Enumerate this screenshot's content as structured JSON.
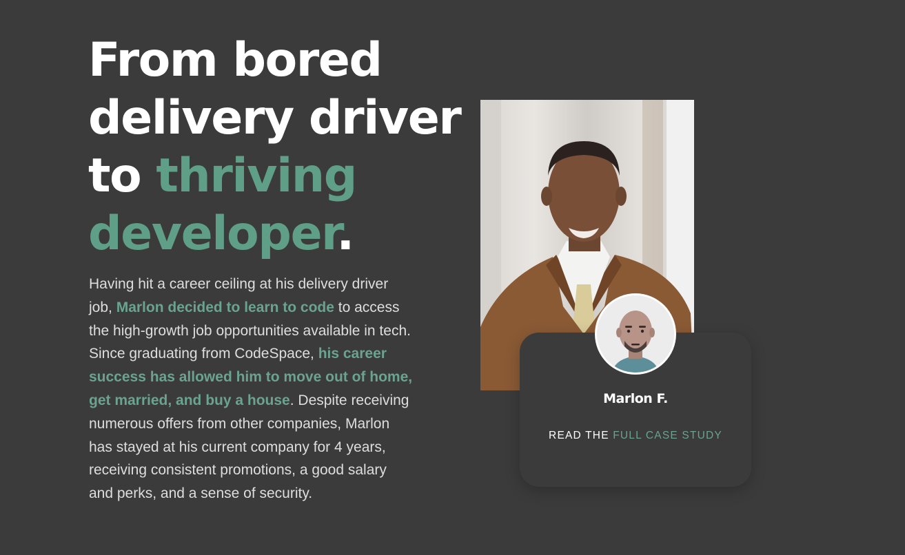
{
  "headline": {
    "line1": "From bored",
    "line2": "delivery driver",
    "line3_plain": "to ",
    "line3_accent": "thriving",
    "line4_accent": "developer",
    "line4_end": "."
  },
  "story": {
    "t1": "Having hit a career ceiling at his delivery driver job, ",
    "h1": "Marlon decided to learn to code",
    "t2": " to access the high-growth job opportunities available in tech. Since graduating from CodeSpace, ",
    "h2": "his career success has allowed him to move out of home, get married, and buy a house",
    "t3": ". Despite receiving numerous offers from other companies, Marlon has stayed at his current company for 4 years, receiving consistent promotions, a good salary and perks, and a sense of security."
  },
  "card": {
    "name": "Marlon F.",
    "cta_prefix": "READ THE ",
    "cta_link": "FULL CASE STUDY"
  },
  "colors": {
    "background": "#3b3b3b",
    "accent": "#5f9f88",
    "text": "#dedede"
  },
  "icons": {
    "avatar": "bald-man-avatar-icon"
  }
}
